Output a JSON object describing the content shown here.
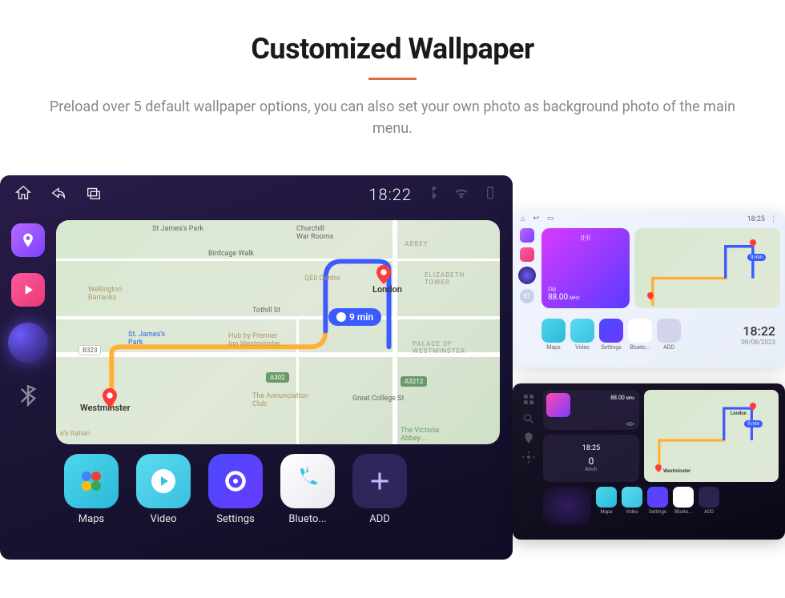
{
  "header": {
    "title": "Customized Wallpaper",
    "subtitle": "Preload over 5 default wallpaper options, you can also set your own photo as background photo of the main menu."
  },
  "main_screen": {
    "status": {
      "time": "18:22"
    },
    "map": {
      "eta": "9 min",
      "labels": {
        "stjames": "St James's Park",
        "churchill": "Churchill\nWar Rooms",
        "abbey": "ABBEY",
        "birdcage": "Birdcage Walk",
        "wellington": "Wellington\nBarracks",
        "tothill": "Tothill St",
        "qeii": "QEII Centre",
        "eliztower": "ELIZABETH\nTOWER",
        "london": "London",
        "stjamespark": "St. James's\nPark",
        "hubvp": "Hub by Premier\nInn Westminster...",
        "palace": "PALACE OF\nWESTMINSTER",
        "westminster": "Westminster",
        "annunciation": "The Annunciation\nClub",
        "greatcollege": "Great College St",
        "esitalian": "e's Italian",
        "victoria": "The Victoria\nAbbey..."
      },
      "badges": {
        "b323": "B323",
        "a302": "A302",
        "a3212": "A3212"
      }
    },
    "dock": [
      {
        "label": "Maps",
        "name": "maps"
      },
      {
        "label": "Video",
        "name": "video"
      },
      {
        "label": "Settings",
        "name": "settings"
      },
      {
        "label": "Blueto...",
        "name": "phone"
      },
      {
        "label": "ADD",
        "name": "add"
      }
    ]
  },
  "light_screen": {
    "status": {
      "time": "18:25"
    },
    "radio": {
      "fm": "FM",
      "freq": "88.00",
      "unit": "MHz",
      "bt": "BT"
    },
    "map": {
      "eta": "9 min"
    },
    "datetime": {
      "time": "18:22",
      "date": "09/06/2023"
    },
    "dock": [
      {
        "label": "Maps"
      },
      {
        "label": "Video"
      },
      {
        "label": "Settings"
      },
      {
        "label": "Blueto..."
      },
      {
        "label": "ADD"
      }
    ]
  },
  "dark_screen": {
    "radio": {
      "freq": "88.00",
      "unit": "MHz"
    },
    "speed": {
      "time": "18:25",
      "value": "0",
      "unit": "Km/h"
    },
    "map": {
      "eta": "9 min",
      "label": "London",
      "label2": "Westminster"
    },
    "dock": [
      {
        "label": "Maps"
      },
      {
        "label": "Video"
      },
      {
        "label": "Settings"
      },
      {
        "label": "Blueto..."
      },
      {
        "label": "ADD"
      }
    ]
  }
}
